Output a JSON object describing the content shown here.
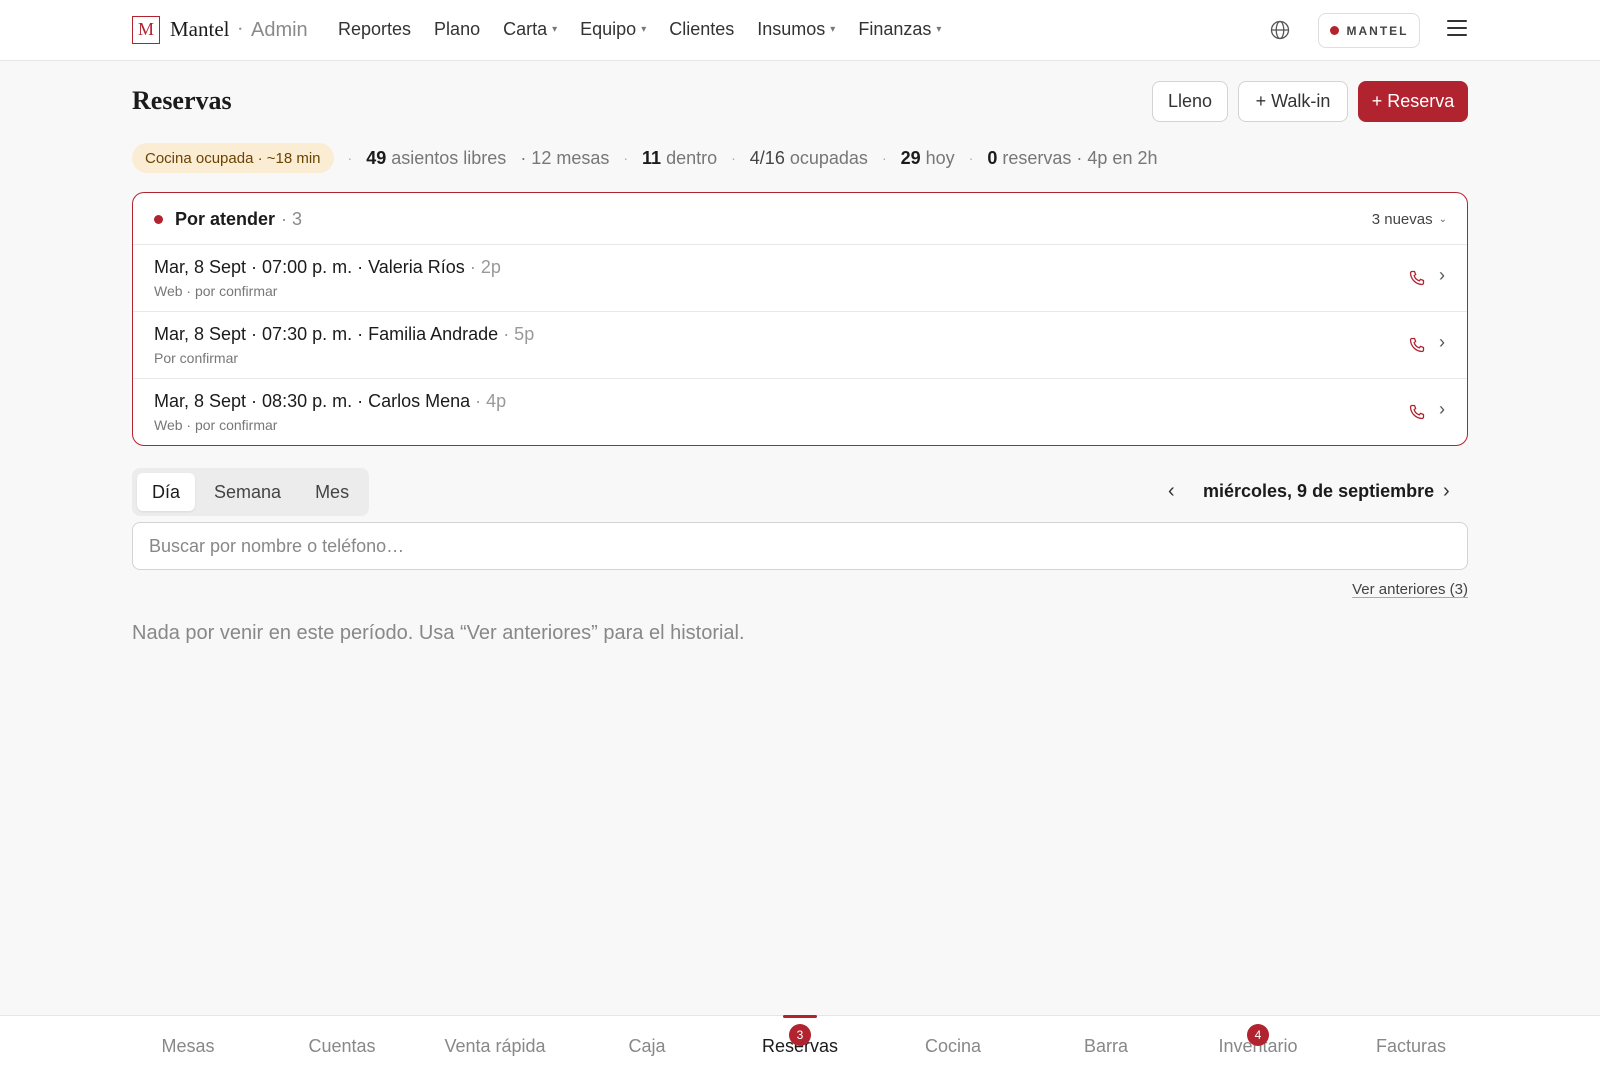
{
  "brand": {
    "logo_letter": "M",
    "name": "Mantel",
    "separator": "·",
    "section": "Admin"
  },
  "nav": {
    "items": [
      {
        "label": "Reportes",
        "caret": ""
      },
      {
        "label": "Plano",
        "caret": ""
      },
      {
        "label": "Carta",
        "caret": "▾"
      },
      {
        "label": "Equipo",
        "caret": "▾"
      },
      {
        "label": "Clientes",
        "caret": ""
      },
      {
        "label": "Insumos",
        "caret": "▾"
      },
      {
        "label": "Finanzas",
        "caret": "▾"
      }
    ],
    "account_label": "MANTEL"
  },
  "header": {
    "title": "Reservas",
    "btn_full": "Lleno",
    "btn_walkin": "+ Walk-in",
    "btn_reserva": "+ Reserva"
  },
  "stats": {
    "kitchen": "Cocina ocupada · ~18 min",
    "seats_num": "49",
    "seats_label": "asientos libres",
    "tables": "· 12 mesas",
    "inside_num": "11",
    "inside_label": "dentro",
    "occupied_num": "4/16",
    "occupied_label": "ocupadas",
    "today_num": "29",
    "today_label": "hoy",
    "upcoming_num": "0",
    "upcoming_label": "reservas · 4p en 2h"
  },
  "pending": {
    "title": "Por atender",
    "count": "· 3",
    "new_label": "3 nuevas",
    "rows": [
      {
        "main": "Mar, 8 Sept · 07:00 p. m. · Valeria Ríos",
        "party": "· 2p",
        "sub": "Web · por confirmar"
      },
      {
        "main": "Mar, 8 Sept · 07:30 p. m. · Familia Andrade",
        "party": "· 5p",
        "sub": "Por confirmar"
      },
      {
        "main": "Mar, 8 Sept · 08:30 p. m. · Carlos Mena",
        "party": "· 4p",
        "sub": "Web · por confirmar"
      }
    ]
  },
  "view": {
    "tabs": [
      "Día",
      "Semana",
      "Mes"
    ],
    "active": "Día",
    "prev": "‹",
    "date": "miércoles, 9 de septiembre",
    "next": "›"
  },
  "search": {
    "placeholder": "Buscar por nombre o teléfono…",
    "value": ""
  },
  "history_link": "Ver anteriores (3)",
  "empty_message": "Nada por venir en este período. Usa “Ver anteriores” para el historial.",
  "bottom_tabs": [
    {
      "label": "Mesas",
      "badge": ""
    },
    {
      "label": "Cuentas",
      "badge": ""
    },
    {
      "label": "Venta rápida",
      "badge": ""
    },
    {
      "label": "Caja",
      "badge": ""
    },
    {
      "label": "Reservas",
      "badge": "3",
      "active": true
    },
    {
      "label": "Cocina",
      "badge": ""
    },
    {
      "label": "Barra",
      "badge": ""
    },
    {
      "label": "Inventario",
      "badge": "4"
    },
    {
      "label": "Facturas",
      "badge": ""
    }
  ],
  "colors": {
    "accent": "#b1232f",
    "kitchen_badge_bg": "#fbecd4",
    "background": "#f8f8f8"
  },
  "icons": {
    "globe": "globe-icon",
    "menu": "hamburger-icon",
    "phone": "phone-icon",
    "chevron": "chevron-right-icon"
  }
}
